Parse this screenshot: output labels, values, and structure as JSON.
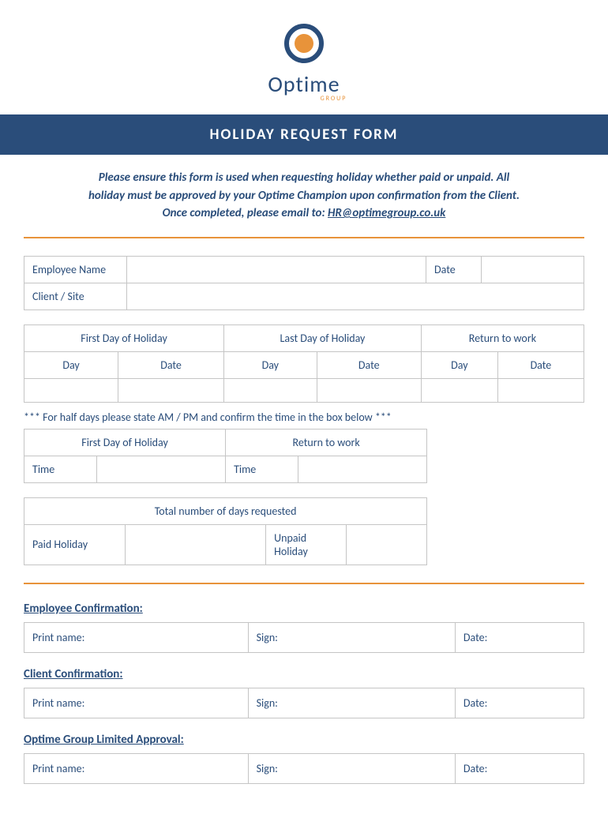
{
  "logo": {
    "brand": "Optime",
    "sub": "GROUP"
  },
  "title": "HOLIDAY REQUEST FORM",
  "instructions": {
    "line1": "Please ensure this form is used when requesting holiday whether paid or unpaid. All",
    "line2": "holiday must be approved by your Optime Champion upon confirmation from the Client.",
    "line3_prefix": "Once completed, please email to: ",
    "email": "HR@optimegroup.co.uk"
  },
  "table1": {
    "employee_name": "Employee Name",
    "date": "Date",
    "client_site": "Client / Site"
  },
  "table2": {
    "h1": "First Day of Holiday",
    "h2": "Last Day of Holiday",
    "h3": "Return to work",
    "sub_day": "Day",
    "sub_date": "Date"
  },
  "half_day_note": "*** For half days please state AM / PM and confirm the time in the box below ***",
  "table3": {
    "h1": "First Day of Holiday",
    "h2": "Return to work",
    "time": "Time"
  },
  "table4": {
    "header": "Total number of days requested",
    "paid": "Paid Holiday",
    "unpaid": "Unpaid Holiday"
  },
  "confirmations": {
    "employee": "Employee Confirmation:",
    "client": "Client Confirmation:",
    "optime": "Optime Group Limited Approval:",
    "print": "Print name:",
    "sign": "Sign:",
    "date": "Date:"
  }
}
